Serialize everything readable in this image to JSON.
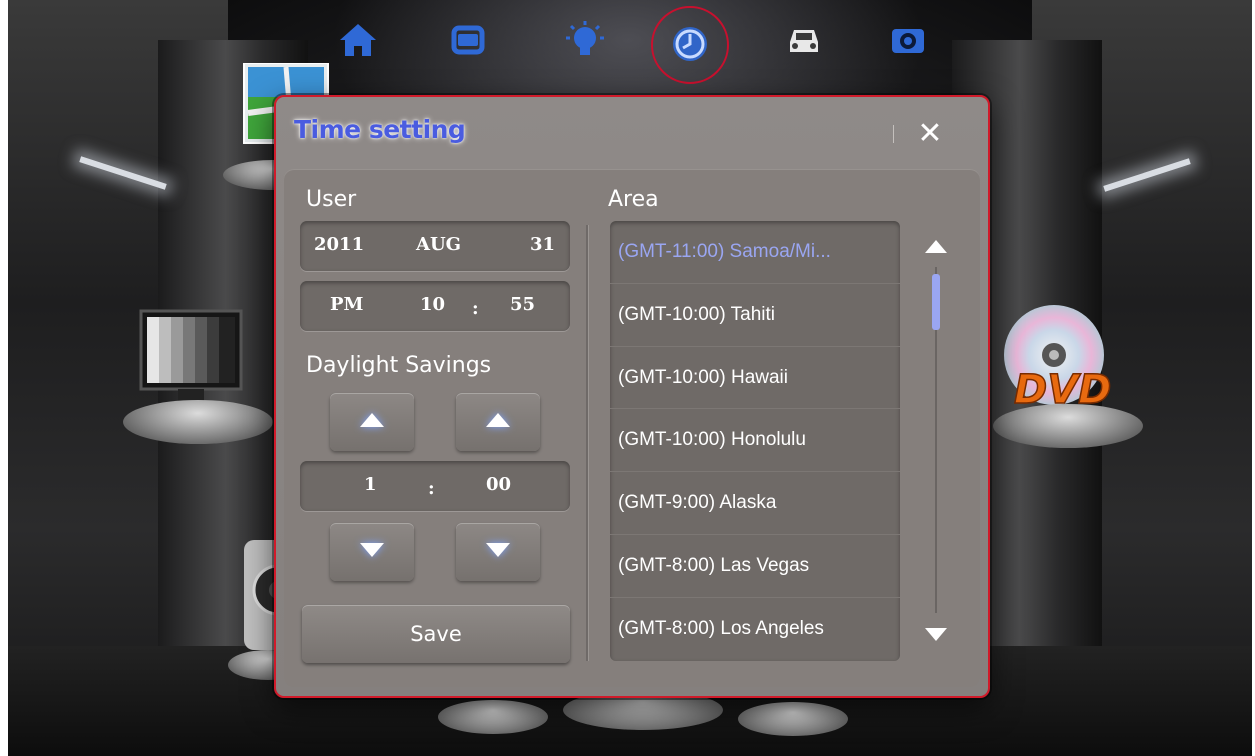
{
  "nav": {
    "items": [
      {
        "name": "home-icon"
      },
      {
        "name": "layers-icon"
      },
      {
        "name": "lightbulb-icon"
      },
      {
        "name": "clock-icon",
        "active": true
      },
      {
        "name": "car-icon"
      },
      {
        "name": "camera-icon"
      }
    ],
    "active_color": "#c8102e",
    "icon_color": "#2f69d6"
  },
  "background": {
    "dvd_label": "DVD"
  },
  "dialog": {
    "title": "Time setting",
    "close_symbol": "✕",
    "user_section": {
      "label": "User",
      "date": {
        "year": "2011",
        "month": "AUG",
        "day": "31"
      },
      "time": {
        "ampm": "PM",
        "hour": "10",
        "separator": ":",
        "minute": "55"
      }
    },
    "daylight": {
      "label": "Daylight Savings",
      "hour": "1",
      "separator": ":",
      "minute": "00"
    },
    "save_label": "Save",
    "area": {
      "label": "Area",
      "items": [
        {
          "label": "(GMT-11:00) Samoa/Mi...",
          "selected": true
        },
        {
          "label": "(GMT-10:00) Tahiti"
        },
        {
          "label": "(GMT-10:00) Hawaii"
        },
        {
          "label": "(GMT-10:00) Honolulu"
        },
        {
          "label": "(GMT-9:00) Alaska"
        },
        {
          "label": "(GMT-8:00) Las Vegas"
        },
        {
          "label": "(GMT-8:00) Los Angeles"
        }
      ]
    },
    "colors": {
      "border": "#d11a2a",
      "title": "#4a5ce0",
      "selected_item": "#9aa6f2"
    }
  }
}
